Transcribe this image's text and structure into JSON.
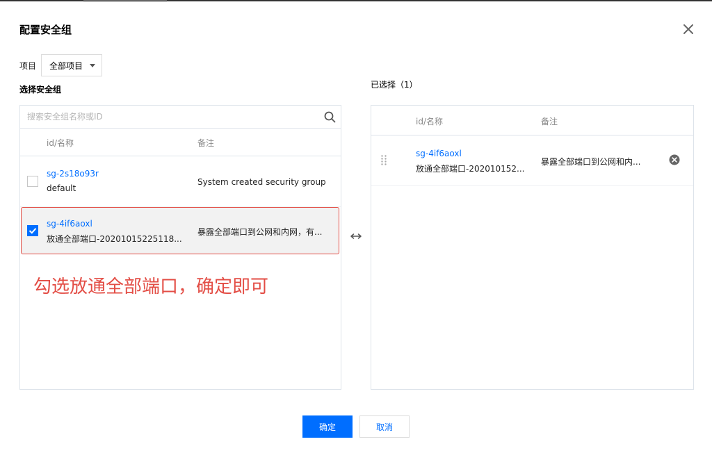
{
  "dialog": {
    "title": "配置安全组",
    "close_icon": "close-icon"
  },
  "project": {
    "label": "项目",
    "selected": "全部项目"
  },
  "left": {
    "section_title": "选择安全组",
    "search_placeholder": "搜索安全组名称或ID",
    "col_id": "id/名称",
    "col_note": "备注",
    "rows": [
      {
        "id": "sg-2s18o93r",
        "name": "default",
        "note": "System created security group",
        "checked": false
      },
      {
        "id": "sg-4if6aoxl",
        "name": "放通全部端口-20201015225118...",
        "note": "暴露全部端口到公网和内网，有...",
        "checked": true
      }
    ]
  },
  "right": {
    "section_title": "已选择（1）",
    "col_id": "id/名称",
    "col_note": "备注",
    "rows": [
      {
        "id": "sg-4if6aoxl",
        "name": "放通全部端口-202010152...",
        "note": "暴露全部端口到公网和内..."
      }
    ]
  },
  "annotation": "勾选放通全部端口，确定即可",
  "buttons": {
    "ok": "确定",
    "cancel": "取消"
  },
  "colors": {
    "primary": "#006eff",
    "annotation": "#e34d45",
    "border": "#dde3ea"
  },
  "icons": [
    "close-icon",
    "chevron-down-icon",
    "search-icon",
    "checkmark-icon",
    "swap-arrow-icon",
    "drag-handle-icon",
    "remove-circle-icon"
  ]
}
